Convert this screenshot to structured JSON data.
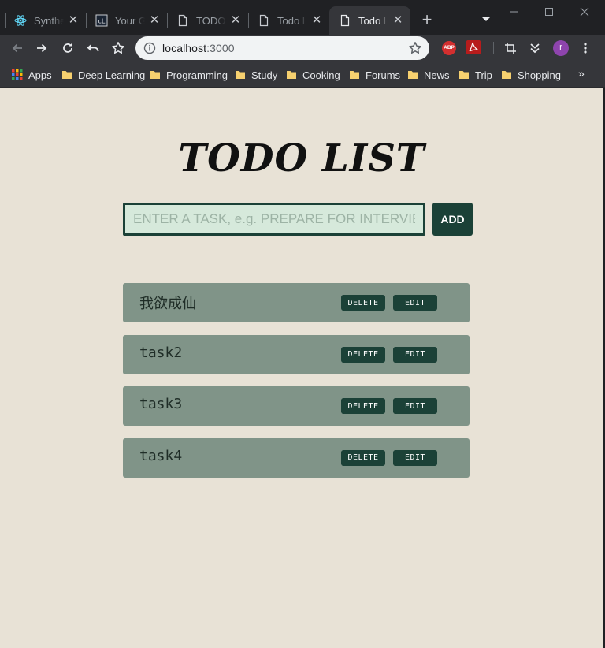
{
  "browser": {
    "tabs": [
      {
        "title": "Synthet",
        "icon": "react-icon"
      },
      {
        "title": "Your Gu",
        "icon": "site-icon"
      },
      {
        "title": "TODO L",
        "icon": "page-icon"
      },
      {
        "title": "Todo Li",
        "icon": "page-icon"
      },
      {
        "title": "Todo Li",
        "icon": "page-icon",
        "active": true
      }
    ],
    "close_glyph": "✕",
    "new_tab_glyph": "+",
    "url_host": "localhost",
    "url_port": ":3000",
    "extensions": {
      "abp_label": "ABP"
    },
    "profile_initial": "r"
  },
  "bookmarks": {
    "apps_label": "Apps",
    "items": [
      "Deep Learning",
      "Programming",
      "Study",
      "Cooking",
      "Forums",
      "News",
      "Trip",
      "Shopping"
    ],
    "more_glyph": "»"
  },
  "app": {
    "title": "TODO LIST",
    "input_placeholder": "ENTER A TASK, e.g. PREPARE FOR INTERVIEW",
    "add_label": "ADD",
    "delete_label": "DELETE",
    "edit_label": "EDIT",
    "tasks": [
      {
        "text": "我欲成仙"
      },
      {
        "text": "task2"
      },
      {
        "text": "task3"
      },
      {
        "text": "task4"
      }
    ]
  },
  "colors": {
    "page_bg": "#e8e2d6",
    "accent_dark_green": "#1b4137",
    "task_bg": "#809488",
    "input_bg": "#d6e9db"
  }
}
